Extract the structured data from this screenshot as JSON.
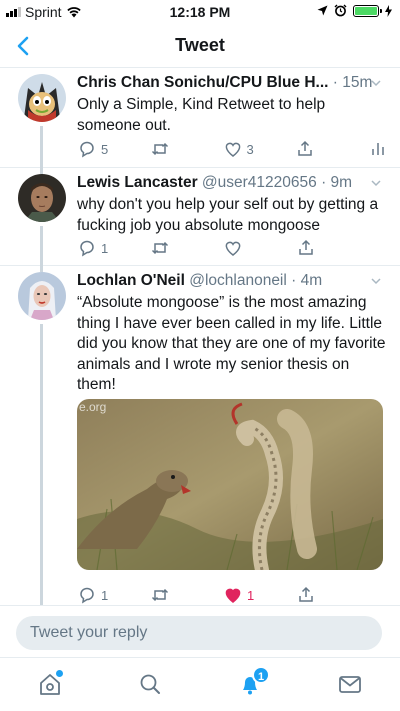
{
  "status_bar": {
    "carrier": "Sprint",
    "time": "12:18 PM"
  },
  "nav": {
    "title": "Tweet",
    "back_icon": "chevron-left-icon"
  },
  "tweets": [
    {
      "name": "Chris Chan Sonichu/CPU Blue H...",
      "handle": "",
      "time": "· 15m",
      "text": "Only a Simple, Kind Retweet to help someone out.",
      "replies": "5",
      "retweets": "",
      "likes": "3",
      "liked": false
    },
    {
      "name": "Lewis Lancaster",
      "handle": "@user41220656",
      "time": "· 9m",
      "text": "why don't you help your self out by getting a fucking job you absolute mongoose",
      "replies": "1",
      "retweets": "",
      "likes": "",
      "liked": false
    },
    {
      "name": "Lochlan O'Neil",
      "handle": "@lochlanoneil",
      "time": "· 4m",
      "text": "“Absolute mongoose” is the most amazing thing I have ever been called in my life. Little did you know that they are one of my favorite animals and I wrote my senior thesis on them!",
      "media_watermark": "e.org",
      "replies": "1",
      "retweets": "",
      "likes": "1",
      "liked": true
    }
  ],
  "reply": {
    "placeholder": "Tweet your reply"
  },
  "tab_bar": {
    "notification_count": "1"
  },
  "colors": {
    "accent": "#1da1f2",
    "like": "#e0245e",
    "secondary_text": "#657786",
    "battery": "#4cd964"
  }
}
